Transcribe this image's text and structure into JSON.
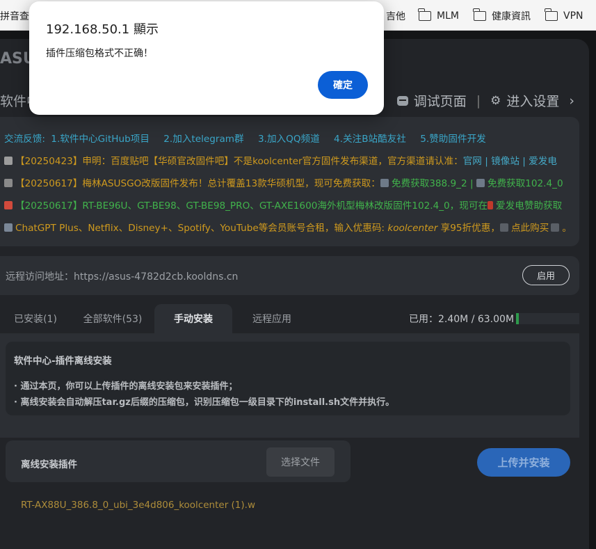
{
  "bookmarks": {
    "partial_left": "拼音查詢",
    "items": [
      {
        "label": "吉他",
        "has_folder": false
      },
      {
        "label": "MLM",
        "has_folder": true
      },
      {
        "label": "健康資訊",
        "has_folder": true
      },
      {
        "label": "VPN",
        "has_folder": true
      }
    ]
  },
  "header": {
    "brand_partial": "ASUS",
    "title_partial": "软件中",
    "debug_page": "调试页面",
    "enter_settings": "进入设置",
    "separator": "|",
    "chevron": "›"
  },
  "notice": {
    "links_prefix": "交流反馈:",
    "links": [
      "1.软件中心GitHub项目",
      "2.加入telegram群",
      "3.加入QQ频道",
      "4.关注B站酷友社",
      "5.赞助固件开发"
    ],
    "line1_text": "【20250423】申明：百度贴吧【华硕官改固件吧】不是koolcenter官方固件发布渠道，官方渠道请认准：",
    "line1_links": [
      "官网",
      "镜像站",
      "爱发电"
    ],
    "line1_sep": "|",
    "line2_text": "【20250617】梅林ASUSGO改版固件发布！总计覆盖13款华硕机型，现可免费获取：",
    "line2_link1": "免费获取388.9_2",
    "line2_link2": "免费获取102.4_0",
    "line3_text": "【20250617】RT-BE96U、GT-BE98、GT-BE98_PRO、GT-AXE1600海外机型梅林改版固件102.4_0，现可在",
    "line3_link": "爱发电赞助获取",
    "line4_text": "ChatGPT Plus、Netflix、Disney+、Spotify、YouTube等会员账号合租，输入优惠码: ",
    "line4_code": "koolcenter",
    "line4_suffix": " 享95折优惠，",
    "line4_link": "点此购买",
    "line4_end": "。"
  },
  "remote": {
    "label": "远程访问地址：https://asus-4782d2cb.kooldns.cn",
    "button": "启用"
  },
  "tabs": [
    {
      "label": "已安装(1)",
      "active": false
    },
    {
      "label": "全部软件(53)",
      "active": false
    },
    {
      "label": "手动安装",
      "active": true
    },
    {
      "label": "远程应用",
      "active": false
    }
  ],
  "usage": {
    "text": "已用：2.40M / 63.00M",
    "fraction": 0.038
  },
  "manual": {
    "title": "软件中心-插件离线安装",
    "line1": "· 通过本页，你可以上传插件的离线安装包来安装插件；",
    "line2": "· 离线安装会自动解压tar.gz后缀的压缩包，识别压缩包一级目录下的install.sh文件并执行。",
    "install_label": "离线安装插件",
    "choose_file": "选择文件",
    "upload_install": "上传并安装",
    "filename": "RT-AX88U_386.8_0_ubi_3e4d806_koolcenter (1).w"
  },
  "dialog": {
    "title": "192.168.50.1 顯示",
    "message": "插件压缩包格式不正确！",
    "ok": "確定"
  },
  "colors": {
    "accent_blue": "#0b5fd6",
    "link_teal": "#45a9c7",
    "notice_yellow": "#cf9a1e",
    "link_green": "#41b34c",
    "usage_green": "#2e9a4c"
  }
}
